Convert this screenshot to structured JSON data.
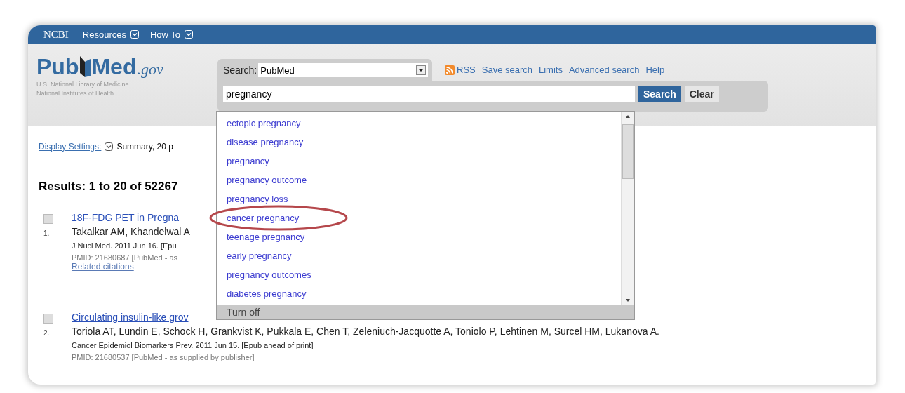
{
  "top_bar": {
    "brand": "NCBI",
    "menus": [
      {
        "label": "Resources"
      },
      {
        "label": "How To"
      }
    ]
  },
  "logo": {
    "name_a": "Pub",
    "name_b": "Med",
    "suffix": ".gov",
    "lines": [
      "U.S. National Library of Medicine",
      "National Institutes of Health"
    ]
  },
  "search": {
    "label": "Search:",
    "database": "PubMed",
    "query": "pregnancy",
    "links": [
      "RSS",
      "Save search",
      "Limits",
      "Advanced search",
      "Help"
    ],
    "buttons": [
      {
        "label": "Search",
        "kind": "primary"
      },
      {
        "label": "Clear",
        "kind": "secondary"
      }
    ]
  },
  "display_settings": {
    "link": "Display Settings:",
    "value": "Summary, 20 p"
  },
  "results_heading": "Results: 1 to 20 of 52267",
  "results": [
    {
      "number": "1.",
      "checked": false,
      "title": "18F-FDG PET in Pregna",
      "authors": "Takalkar AM, Khandelwal A",
      "source": "J Nucl Med. 2011 Jun 16. [Epu",
      "pmid": "PMID: 21680687 [PubMed - as",
      "related": "Related citations"
    },
    {
      "number": "2.",
      "checked": false,
      "title": "Circulating insulin-like grov",
      "authors": "Toriola AT, Lundin E, Schock H, Grankvist K, Pukkala E, Chen T, Zeleniuch-Jacquotte A, Toniolo P, Lehtinen M, Surcel HM, Lukanova A.",
      "source": "Cancer Epidemiol Biomarkers Prev. 2011 Jun 15. [Epub ahead of print]",
      "pmid": "PMID: 21680537 [PubMed - as supplied by publisher]"
    }
  ],
  "suggestions": {
    "items": [
      {
        "label": "ectopic pregnancy",
        "circled": false
      },
      {
        "label": "disease pregnancy",
        "circled": false
      },
      {
        "label": "pregnancy",
        "circled": false
      },
      {
        "label": "pregnancy outcome",
        "circled": false
      },
      {
        "label": "pregnancy loss",
        "circled": false
      },
      {
        "label": "cancer pregnancy",
        "circled": true
      },
      {
        "label": "teenage pregnancy",
        "circled": false
      },
      {
        "label": "early pregnancy",
        "circled": false
      },
      {
        "label": "pregnancy outcomes",
        "circled": false
      },
      {
        "label": "diabetes pregnancy",
        "circled": false
      }
    ],
    "footer": "Turn off"
  }
}
